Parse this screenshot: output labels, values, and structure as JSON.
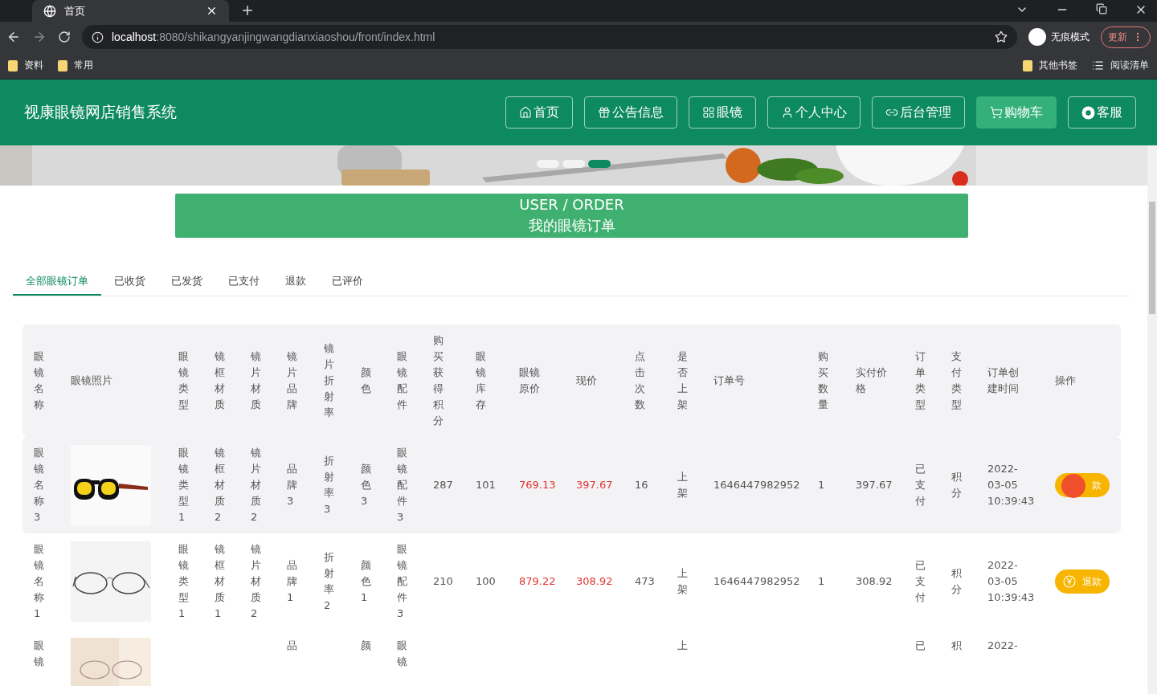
{
  "browser": {
    "tab_title": "首页",
    "url_host": "localhost",
    "url_path": ":8080/shikangyanjingwangdianxiaoshou/front/index.html",
    "incognito": "无痕模式",
    "update": "更新",
    "bookmarks": [
      "资料",
      "常用"
    ],
    "other_bookmarks": "其他书签",
    "reading_list": "阅读清单"
  },
  "header": {
    "title": "视康眼镜网店销售系统",
    "nav": [
      {
        "kind": "home",
        "label": "首页",
        "selected": false
      },
      {
        "kind": "gift",
        "label": "公告信息",
        "selected": false
      },
      {
        "kind": "grid",
        "label": "眼镜",
        "selected": false
      },
      {
        "kind": "user",
        "label": "个人中心",
        "selected": false
      },
      {
        "kind": "link",
        "label": "后台管理",
        "selected": false
      },
      {
        "kind": "cart",
        "label": "购物车",
        "selected": true
      },
      {
        "kind": "service",
        "label": "客服",
        "selected": false
      }
    ]
  },
  "banner": {
    "kind": "picture",
    "carousel": [
      {
        "selected": false
      },
      {
        "selected": false
      },
      {
        "selected": true
      }
    ]
  },
  "section": {
    "subtitle": "USER / ORDER",
    "title": "我的眼镜订单"
  },
  "tabs": [
    {
      "label": "全部眼镜订单",
      "selected": true
    },
    {
      "label": "已收货",
      "selected": false
    },
    {
      "label": "已发货",
      "selected": false
    },
    {
      "label": "已支付",
      "selected": false
    },
    {
      "label": "退款",
      "selected": false
    },
    {
      "label": "已评价",
      "selected": false
    }
  ],
  "table": {
    "columns": [
      "眼镜名称",
      "眼镜照片",
      "眼镜类型",
      "镜框材质",
      "镜片材质",
      "镜片品牌",
      "镜片折射率",
      "颜色",
      "眼镜配件",
      "购买获得积分",
      "眼镜库存",
      "眼镜原价",
      "现价",
      "点击次数",
      "是否上架",
      "订单号",
      "购买数量",
      "实付价格",
      "订单类型",
      "支付类型",
      "订单创建时间",
      "操作"
    ],
    "rows": [
      {
        "kind": "full",
        "highlighted": true,
        "cells": [
          "眼镜名称3",
          {
            "kind": "picture"
          },
          "眼镜类型1",
          "镜框材质2",
          "镜片材质2",
          "品牌3",
          "折射率3",
          "颜色3",
          "眼镜配件3",
          "287",
          "101",
          {
            "price": "769.13"
          },
          {
            "price": "397.67"
          },
          "16",
          "上架",
          "1646447982952",
          "1",
          "397.67",
          "已支付",
          "积分",
          "2022-03-05 10:39:43",
          {
            "button": "款",
            "pressed": true
          }
        ]
      },
      {
        "kind": "full",
        "highlighted": false,
        "cells": [
          "眼镜名称1",
          {
            "kind": "picture"
          },
          "眼镜类型1",
          "镜框材质1",
          "镜片材质2",
          "品牌1",
          "折射率2",
          "颜色1",
          "眼镜配件3",
          "210",
          "100",
          {
            "price": "879.22"
          },
          {
            "price": "308.92"
          },
          "473",
          "上架",
          "1646447982952",
          "1",
          "308.92",
          "已支付",
          "积分",
          "2022-03-05 10:39:43",
          {
            "button": "退款",
            "pressed": false
          }
        ]
      },
      {
        "kind": "cut",
        "highlighted": false,
        "cells": [
          "眼镜",
          {
            "kind": "picture"
          },
          null,
          null,
          null,
          "品",
          null,
          "颜",
          "眼镜",
          null,
          null,
          null,
          null,
          null,
          "上",
          null,
          null,
          null,
          "已",
          "积",
          "2022-",
          null
        ]
      }
    ]
  }
}
